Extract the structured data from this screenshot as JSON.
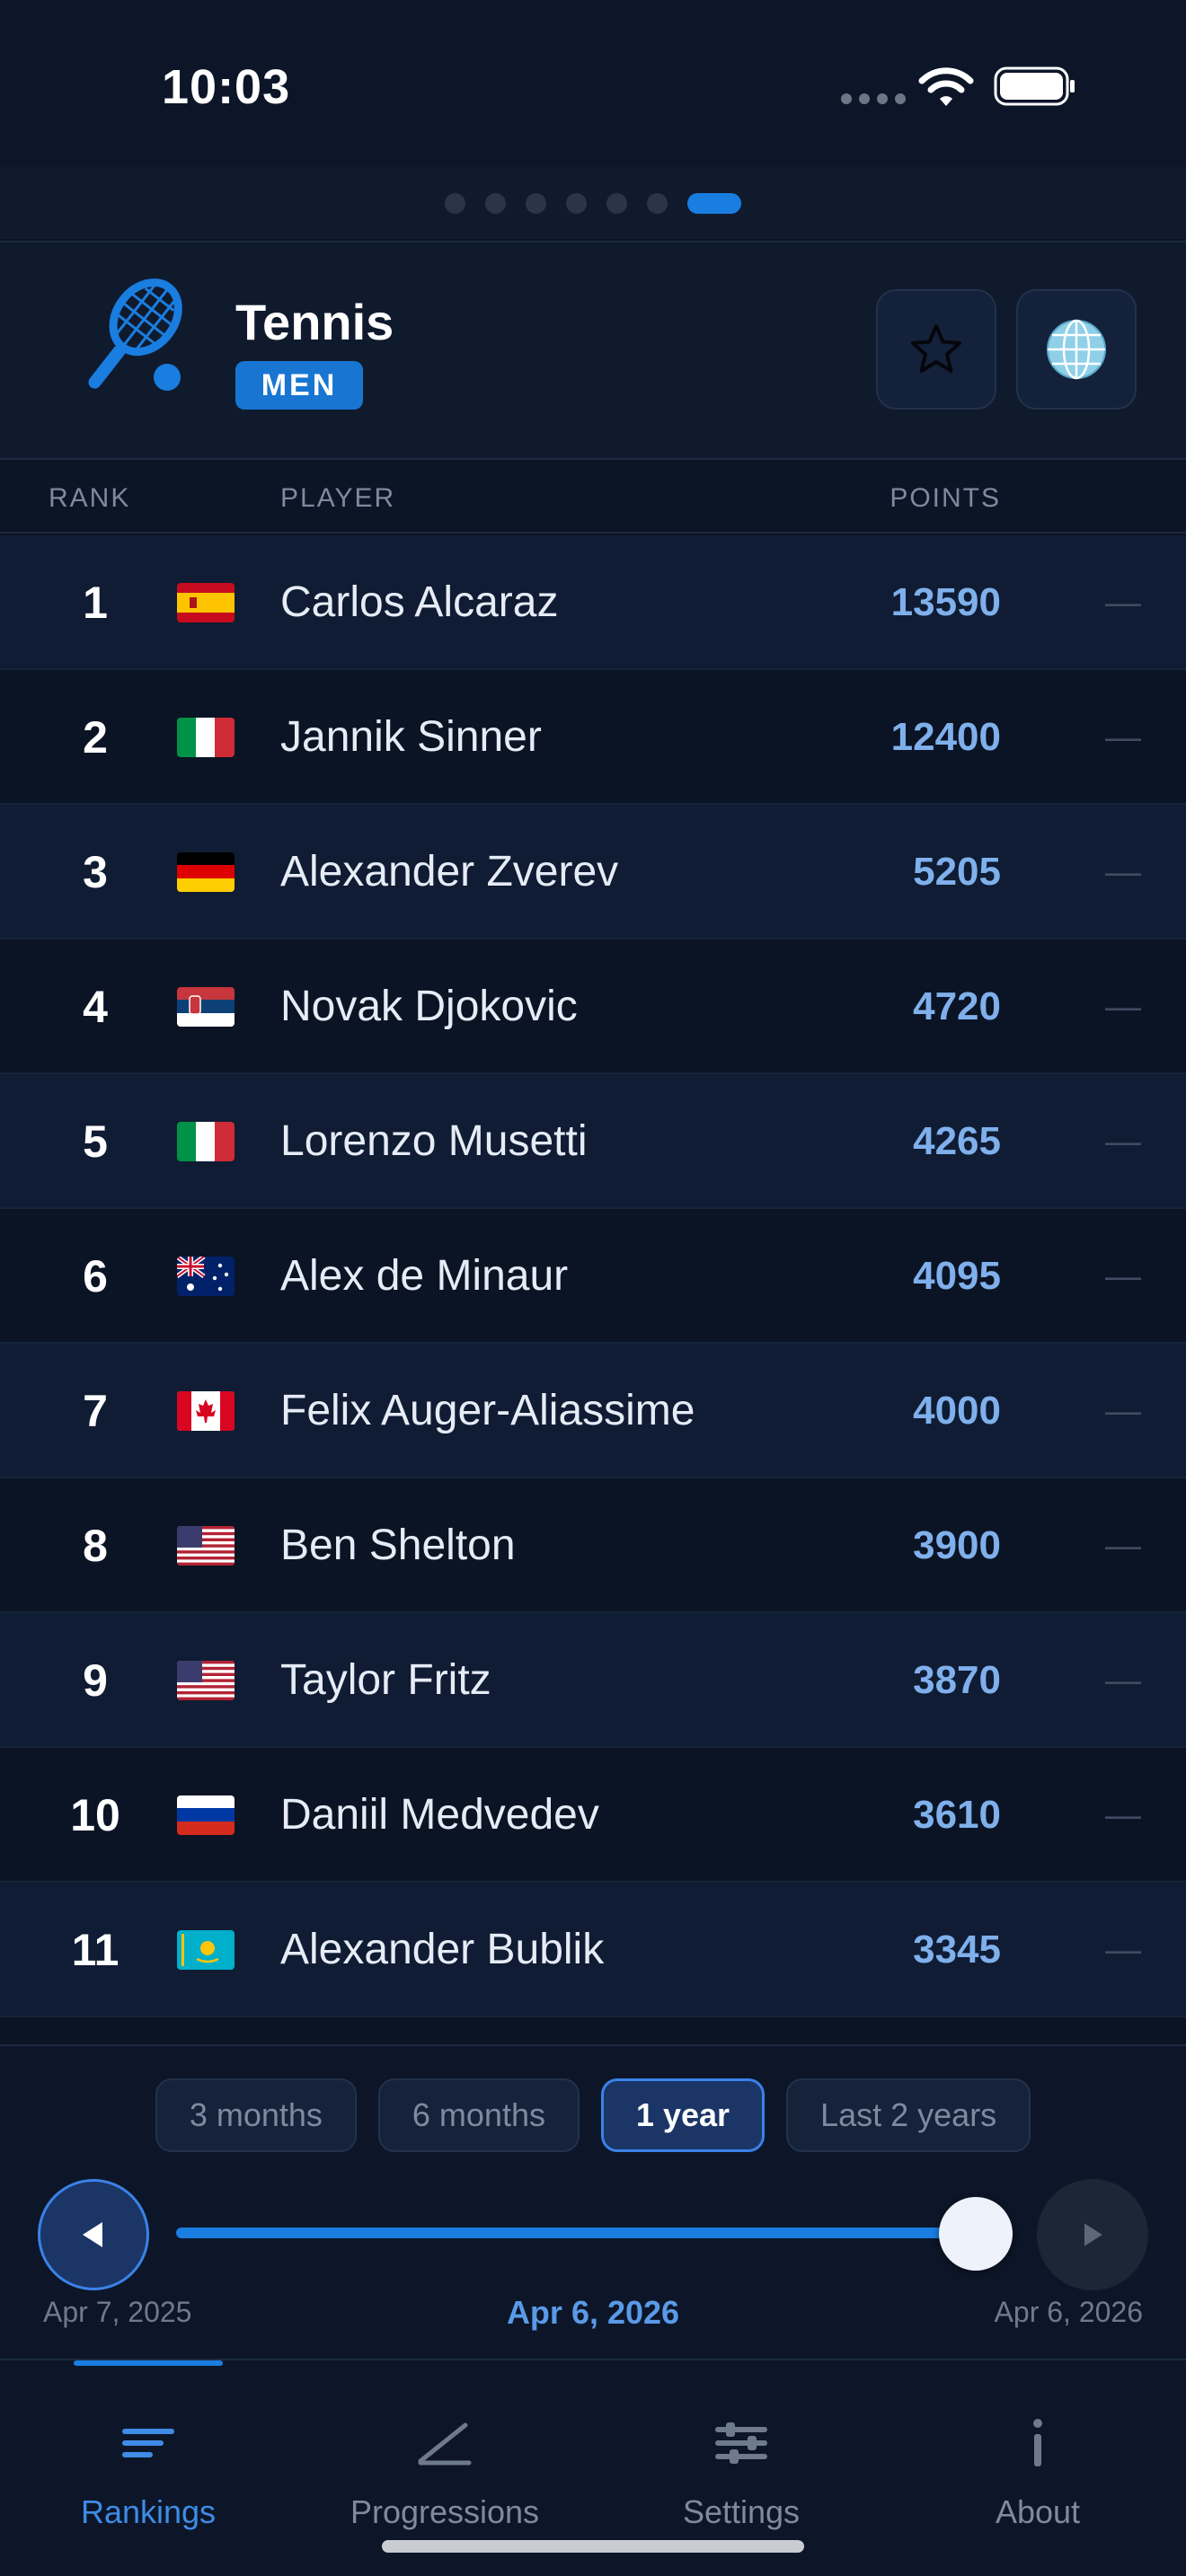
{
  "status_bar": {
    "time": "10:03"
  },
  "header": {
    "title": "Tennis",
    "badge": "MEN",
    "sport_icon": "tennis-racket-icon",
    "favorite_icon": "star-icon",
    "region_icon": "globe-icon"
  },
  "page_dots": {
    "count": 7,
    "active_index": 6
  },
  "table": {
    "headers": {
      "rank": "RANK",
      "player": "PLAYER",
      "points": "POINTS"
    },
    "rows": [
      {
        "rank": "1",
        "flag": "Spain",
        "player": "Carlos Alcaraz",
        "points": "13590",
        "trend": "—"
      },
      {
        "rank": "2",
        "flag": "Italy",
        "player": "Jannik Sinner",
        "points": "12400",
        "trend": "—"
      },
      {
        "rank": "3",
        "flag": "Germany",
        "player": "Alexander Zverev",
        "points": "5205",
        "trend": "—"
      },
      {
        "rank": "4",
        "flag": "Serbia",
        "player": "Novak Djokovic",
        "points": "4720",
        "trend": "—"
      },
      {
        "rank": "5",
        "flag": "Italy",
        "player": "Lorenzo Musetti",
        "points": "4265",
        "trend": "—"
      },
      {
        "rank": "6",
        "flag": "Australia",
        "player": "Alex de Minaur",
        "points": "4095",
        "trend": "—"
      },
      {
        "rank": "7",
        "flag": "Canada",
        "player": "Felix Auger-Aliassime",
        "points": "4000",
        "trend": "—"
      },
      {
        "rank": "8",
        "flag": "USA",
        "player": "Ben Shelton",
        "points": "3900",
        "trend": "—"
      },
      {
        "rank": "9",
        "flag": "USA",
        "player": "Taylor Fritz",
        "points": "3870",
        "trend": "—"
      },
      {
        "rank": "10",
        "flag": "Russia",
        "player": "Daniil Medvedev",
        "points": "3610",
        "trend": "—"
      },
      {
        "rank": "11",
        "flag": "Kazakhstan",
        "player": "Alexander Bublik",
        "points": "3345",
        "trend": "—"
      }
    ]
  },
  "controls": {
    "periods": [
      {
        "label": "3 months",
        "active": false
      },
      {
        "label": "6 months",
        "active": false
      },
      {
        "label": "1 year",
        "active": true
      },
      {
        "label": "Last 2 years",
        "active": false
      }
    ],
    "prev_icon": "play-left-icon",
    "next_icon": "play-right-icon",
    "timeline_position": 1.0,
    "date_start": "Apr 7, 2025",
    "date_current": "Apr 6, 2026",
    "date_end": "Apr 6, 2026"
  },
  "tabbar": {
    "tabs": [
      {
        "label": "Rankings",
        "icon": "rankings-icon",
        "active": true
      },
      {
        "label": "Progressions",
        "icon": "progressions-icon",
        "active": false
      },
      {
        "label": "Settings",
        "icon": "settings-icon",
        "active": false
      },
      {
        "label": "About",
        "icon": "info-icon",
        "active": false
      }
    ]
  },
  "colors": {
    "accent": "#1a7de0",
    "points": "#7fb0ec",
    "background": "#0b1424"
  }
}
